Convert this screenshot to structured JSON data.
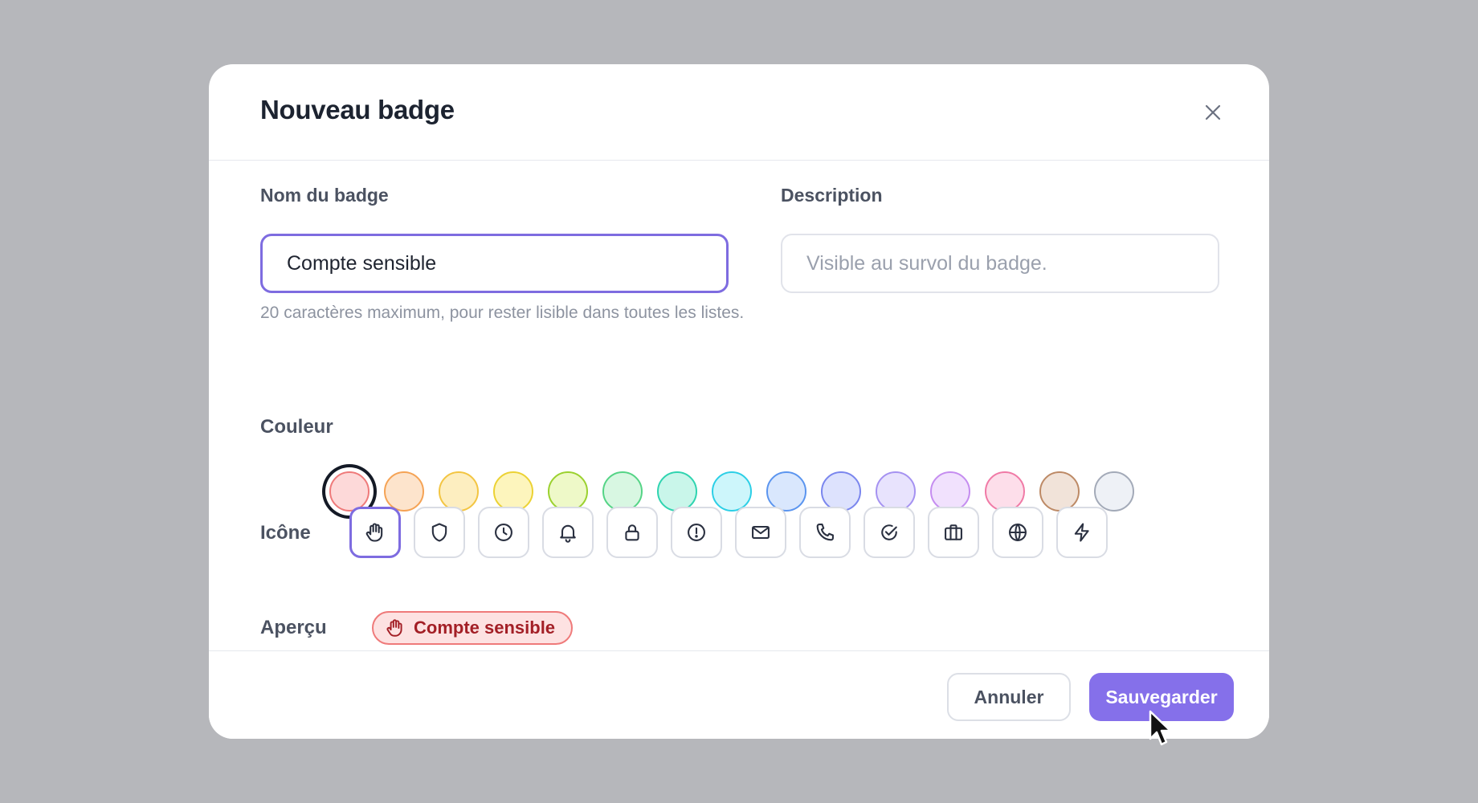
{
  "modal": {
    "title": "Nouveau badge"
  },
  "name_field": {
    "label": "Nom du badge",
    "value": "Compte sensible",
    "hint": "20 caractères maximum, pour rester lisible dans toutes les listes."
  },
  "description_field": {
    "label": "Description",
    "placeholder": "Visible au survol du badge."
  },
  "color_picker": {
    "label": "Couleur",
    "selected_index": 0,
    "swatches": [
      {
        "fill": "#fdd9d9",
        "border": "#ef7a7a"
      },
      {
        "fill": "#fde4cc",
        "border": "#f5a355"
      },
      {
        "fill": "#fdeec0",
        "border": "#f3c542"
      },
      {
        "fill": "#fdf5bd",
        "border": "#ecd234"
      },
      {
        "fill": "#eef9c8",
        "border": "#9bd12f"
      },
      {
        "fill": "#d8f7e2",
        "border": "#55d486"
      },
      {
        "fill": "#c9f6ea",
        "border": "#2fd4b0"
      },
      {
        "fill": "#cdf6fb",
        "border": "#2ccfe6"
      },
      {
        "fill": "#d9e7fd",
        "border": "#5b95ef"
      },
      {
        "fill": "#dde2fd",
        "border": "#7a86ee"
      },
      {
        "fill": "#e8e3fd",
        "border": "#a592f1"
      },
      {
        "fill": "#f1e1fd",
        "border": "#c58df0"
      },
      {
        "fill": "#fddeea",
        "border": "#f07aa6"
      },
      {
        "fill": "#f1e3d9",
        "border": "#bd8a66"
      },
      {
        "fill": "#eef1f6",
        "border": "#a3aab8"
      }
    ]
  },
  "icon_picker": {
    "label": "Icône",
    "selected_index": 0,
    "icons": [
      "hand-icon",
      "shield-icon",
      "clock-icon",
      "bell-icon",
      "lock-icon",
      "alert-circle-icon",
      "mail-icon",
      "phone-icon",
      "check-circle-icon",
      "briefcase-icon",
      "globe-icon",
      "lightning-icon"
    ]
  },
  "preview": {
    "label": "Aperçu",
    "badge_text": "Compte sensible",
    "badge_icon": "hand-icon"
  },
  "footer": {
    "cancel_label": "Annuler",
    "save_label": "Sauvegarder"
  },
  "colors": {
    "accent": "#8570ea",
    "focus_border": "#7e6ce0",
    "badge_text": "#a31f26"
  }
}
